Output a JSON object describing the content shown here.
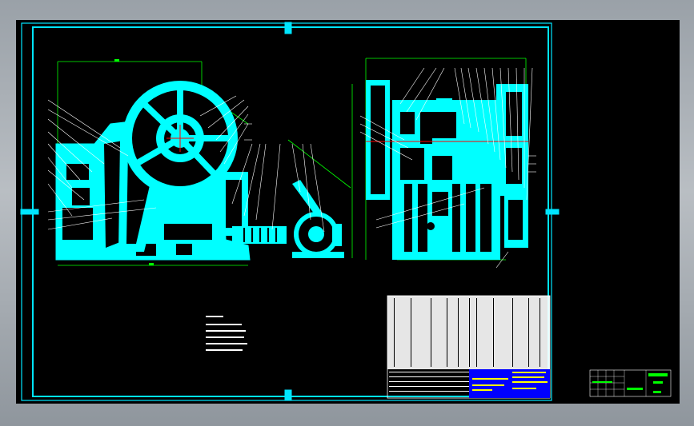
{
  "drawing": {
    "colors": {
      "background": "#000000",
      "frame": "#00e5ff",
      "part": "#00ffff",
      "leader": "#ffffff",
      "dimension": "#00ff00",
      "centerline": "#ff0000",
      "title_text": "#ffff00",
      "title_box": "#0000ff"
    },
    "views": [
      "front-elevation",
      "side-elevation"
    ],
    "title_block": {
      "main_title": "",
      "drawing_number": ""
    },
    "small_title_block": {
      "title": "",
      "number": ""
    }
  }
}
